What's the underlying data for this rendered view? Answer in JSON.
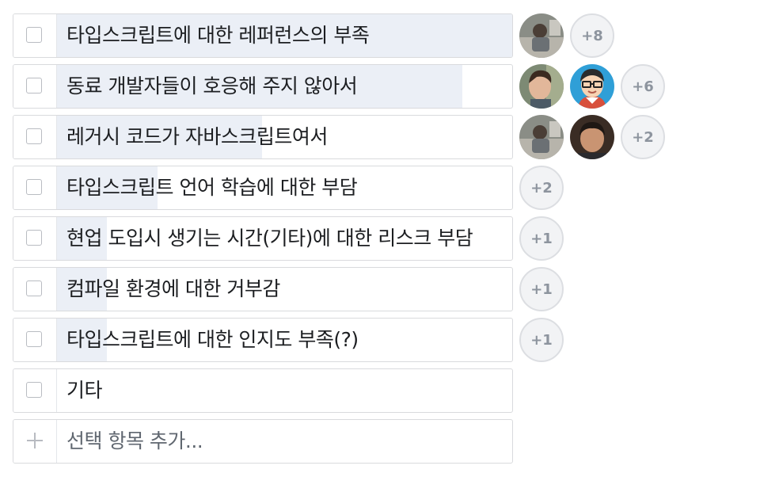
{
  "poll": {
    "options": [
      {
        "label": "타입스크립트에 대한 레퍼런스의 부족",
        "vote_share": 1.0,
        "voters": [
          "photo-a"
        ],
        "more": "+8"
      },
      {
        "label": "동료 개발자들이 호응해 주지 않아서",
        "vote_share": 0.89,
        "voters": [
          "photo-b",
          "cartoon"
        ],
        "more": "+6"
      },
      {
        "label": "레거시 코드가 자바스크립트여서",
        "vote_share": 0.45,
        "voters": [
          "photo-a",
          "photo-c"
        ],
        "more": "+2"
      },
      {
        "label": "타입스크립트 언어 학습에 대한 부담",
        "vote_share": 0.22,
        "voters": [],
        "more": "+2"
      },
      {
        "label": "현업 도입시 생기는 시간(기타)에 대한 리스크 부담",
        "vote_share": 0.11,
        "voters": [],
        "more": "+1"
      },
      {
        "label": "컴파일 환경에 대한 거부감",
        "vote_share": 0.11,
        "voters": [],
        "more": "+1"
      },
      {
        "label": "타입스크립트에 대한 인지도 부족(?)",
        "vote_share": 0.11,
        "voters": [],
        "more": "+1"
      },
      {
        "label": "기타",
        "vote_share": 0,
        "voters": [],
        "more": ""
      }
    ],
    "add_option_placeholder": "선택 항목 추가..."
  },
  "colors": {
    "vote_fill": "#ebeff6",
    "border": "#d9dadd",
    "more_badge_bg": "#f2f3f5",
    "more_badge_text": "#8d949e"
  }
}
